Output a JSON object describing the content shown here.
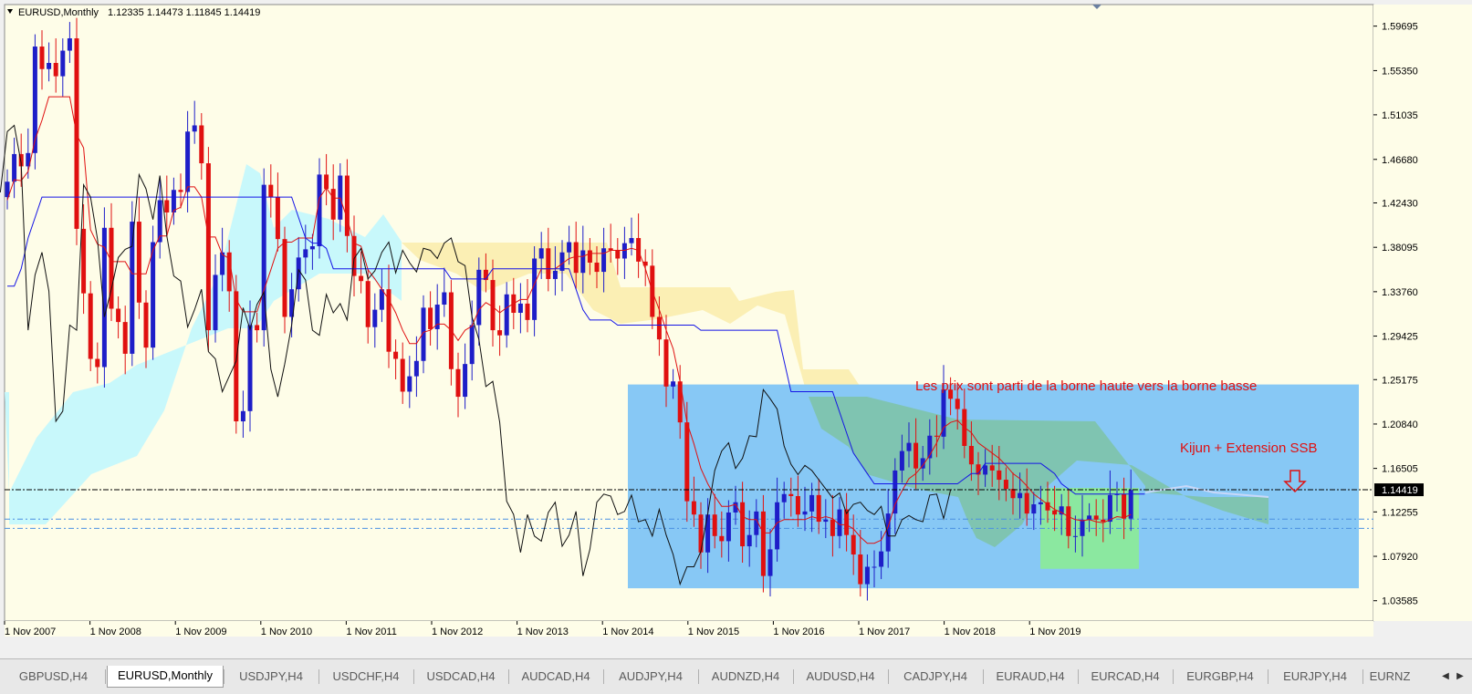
{
  "chart": {
    "symbol_info": "EURUSD,Monthly",
    "ohlc_text": "1.12335 1.14473 1.11845 1.14419",
    "current_price": "1.14419",
    "colors": {
      "background": "#fefde8",
      "bull": "#1e1ec8",
      "bear": "#e01010",
      "tenkan": "#e01010",
      "kijun": "#1414e6",
      "chikou": "#101010",
      "kumo_bull": "#c8f8fb",
      "kumo_bear": "#fbefb4",
      "range_box": "#87c8f5",
      "target_box": "#8be8a0",
      "annotation": "#e01010"
    },
    "annotations": [
      "Les prix sont parti de la borne haute vers la borne basse",
      "Kijun + Extension SSB"
    ],
    "arrow_icon": "down-arrow-icon"
  },
  "chart_data": {
    "type": "candlestick",
    "ylim": [
      1.016,
      1.618
    ],
    "price_ticks": [
      "1.59695",
      "1.55350",
      "1.51035",
      "1.46680",
      "1.42430",
      "1.38095",
      "1.33760",
      "1.29425",
      "1.25175",
      "1.20840",
      "1.16505",
      "1.12255",
      "1.07920",
      "1.03585"
    ],
    "time_ticks": [
      "1 Nov 2007",
      "1 Nov 2008",
      "1 Nov 2009",
      "1 Nov 2010",
      "1 Nov 2011",
      "1 Nov 2012",
      "1 Nov 2013",
      "1 Nov 2014",
      "1 Nov 2015",
      "1 Nov 2016",
      "1 Nov 2017",
      "1 Nov 2018",
      "1 Nov 2019"
    ],
    "levels": {
      "current": 1.14419,
      "dash_line_1": 1.1155,
      "dash_line_2": 1.1065
    },
    "range_box": {
      "top": 1.247,
      "bottom": 1.048
    },
    "target_box": {
      "top": 1.146,
      "bottom": 1.067
    },
    "series": [
      {
        "name": "EURUSD",
        "close": [
          1.445,
          1.472,
          1.46,
          1.473,
          1.577,
          1.555,
          1.561,
          1.548,
          1.573,
          1.585,
          1.399,
          1.336,
          1.272,
          1.264,
          1.4,
          1.321,
          1.308,
          1.277,
          1.406,
          1.327,
          1.283,
          1.386,
          1.427,
          1.415,
          1.437,
          1.435,
          1.494,
          1.5,
          1.463,
          1.3,
          1.354,
          1.376,
          1.338,
          1.211,
          1.221,
          1.305,
          1.3,
          1.442,
          1.43,
          1.389,
          1.313,
          1.34,
          1.371,
          1.379,
          1.382,
          1.452,
          1.438,
          1.408,
          1.451,
          1.392,
          1.353,
          1.348,
          1.303,
          1.32,
          1.34,
          1.279,
          1.272,
          1.24,
          1.255,
          1.27,
          1.322,
          1.301,
          1.325,
          1.337,
          1.262,
          1.235,
          1.267,
          1.305,
          1.359,
          1.349,
          1.3,
          1.295,
          1.335,
          1.317,
          1.326,
          1.31,
          1.37,
          1.38,
          1.35,
          1.358,
          1.376,
          1.386,
          1.356,
          1.378,
          1.366,
          1.357,
          1.38,
          1.378,
          1.37,
          1.385,
          1.39,
          1.367,
          1.363,
          1.313,
          1.291,
          1.245,
          1.25,
          1.21,
          1.133,
          1.12,
          1.083,
          1.12,
          1.099,
          1.094,
          1.122,
          1.132,
          1.089,
          1.1,
          1.123,
          1.06,
          1.086,
          1.132,
          1.14,
          1.138,
          1.12,
          1.123,
          1.139,
          1.113,
          1.115,
          1.099,
          1.125,
          1.1,
          1.081,
          1.052,
          1.069,
          1.069,
          1.084,
          1.121,
          1.163,
          1.182,
          1.19,
          1.165,
          1.175,
          1.197,
          1.196,
          1.242,
          1.233,
          1.223,
          1.187,
          1.169,
          1.159,
          1.168,
          1.163,
          1.154,
          1.145,
          1.136,
          1.141,
          1.121,
          1.13,
          1.132,
          1.124,
          1.12,
          1.128,
          1.099,
          1.099,
          1.115,
          1.119,
          1.115,
          1.113,
          1.139,
          1.14,
          1.116,
          1.144
        ]
      },
      {
        "name": "Tenkan",
        "values": [
          1.427,
          1.447,
          1.446,
          1.455,
          1.486,
          1.505,
          1.528,
          1.528,
          1.528,
          1.528,
          1.491,
          1.478,
          1.398,
          1.384,
          1.381,
          1.367,
          1.367,
          1.367,
          1.355,
          1.355,
          1.355,
          1.378,
          1.392,
          1.392,
          1.417,
          1.42,
          1.44,
          1.44,
          1.43,
          1.391,
          1.391,
          1.374,
          1.37,
          1.33,
          1.318,
          1.318,
          1.318,
          1.339,
          1.359,
          1.38,
          1.386,
          1.386,
          1.39,
          1.39,
          1.39,
          1.429,
          1.439,
          1.429,
          1.429,
          1.409,
          1.385,
          1.382,
          1.359,
          1.35,
          1.34,
          1.33,
          1.317,
          1.3,
          1.287,
          1.287,
          1.298,
          1.3,
          1.306,
          1.306,
          1.3,
          1.29,
          1.3,
          1.304,
          1.32,
          1.327,
          1.323,
          1.317,
          1.322,
          1.326,
          1.33,
          1.33,
          1.345,
          1.36,
          1.36,
          1.36,
          1.365,
          1.37,
          1.372,
          1.372,
          1.375,
          1.375,
          1.375,
          1.378,
          1.378,
          1.378,
          1.38,
          1.378,
          1.36,
          1.338,
          1.32,
          1.3,
          1.282,
          1.25,
          1.21,
          1.189,
          1.165,
          1.15,
          1.138,
          1.128,
          1.128,
          1.13,
          1.118,
          1.115,
          1.115,
          1.102,
          1.102,
          1.112,
          1.115,
          1.115,
          1.115,
          1.115,
          1.118,
          1.116,
          1.118,
          1.116,
          1.11,
          1.11,
          1.106,
          1.098,
          1.092,
          1.092,
          1.095,
          1.108,
          1.13,
          1.143,
          1.155,
          1.16,
          1.168,
          1.178,
          1.19,
          1.205,
          1.21,
          1.212,
          1.205,
          1.2,
          1.19,
          1.185,
          1.18,
          1.175,
          1.168,
          1.16,
          1.155,
          1.148,
          1.14,
          1.135,
          1.13,
          1.125,
          1.122,
          1.118,
          1.115,
          1.114,
          1.115,
          1.113,
          1.112,
          1.115,
          1.118,
          1.117,
          1.12
        ]
      },
      {
        "name": "Kijun",
        "values": [
          1.343,
          1.343,
          1.36,
          1.39,
          1.41,
          1.43,
          1.43,
          1.43,
          1.43,
          1.43,
          1.43,
          1.43,
          1.43,
          1.43,
          1.43,
          1.43,
          1.43,
          1.43,
          1.43,
          1.43,
          1.43,
          1.43,
          1.43,
          1.43,
          1.43,
          1.43,
          1.43,
          1.43,
          1.43,
          1.43,
          1.43,
          1.43,
          1.43,
          1.43,
          1.43,
          1.43,
          1.43,
          1.43,
          1.43,
          1.43,
          1.43,
          1.43,
          1.41,
          1.39,
          1.385,
          1.385,
          1.38,
          1.36,
          1.36,
          1.36,
          1.36,
          1.36,
          1.36,
          1.36,
          1.36,
          1.36,
          1.36,
          1.36,
          1.36,
          1.36,
          1.36,
          1.36,
          1.36,
          1.36,
          1.35,
          1.35,
          1.35,
          1.35,
          1.35,
          1.35,
          1.36,
          1.36,
          1.36,
          1.36,
          1.36,
          1.36,
          1.36,
          1.36,
          1.36,
          1.36,
          1.36,
          1.36,
          1.34,
          1.32,
          1.31,
          1.31,
          1.31,
          1.31,
          1.305,
          1.305,
          1.305,
          1.305,
          1.305,
          1.305,
          1.305,
          1.305,
          1.305,
          1.305,
          1.305,
          1.305,
          1.3,
          1.3,
          1.3,
          1.3,
          1.3,
          1.3,
          1.3,
          1.3,
          1.3,
          1.3,
          1.3,
          1.3,
          1.27,
          1.24,
          1.24,
          1.24,
          1.24,
          1.24,
          1.24,
          1.24,
          1.22,
          1.2,
          1.18,
          1.17,
          1.16,
          1.15,
          1.15,
          1.15,
          1.15,
          1.15,
          1.15,
          1.15,
          1.15,
          1.15,
          1.15,
          1.15,
          1.15,
          1.15,
          1.155,
          1.16,
          1.16,
          1.17,
          1.17,
          1.17,
          1.17,
          1.17,
          1.17,
          1.17,
          1.17,
          1.17,
          1.165,
          1.16,
          1.15,
          1.145,
          1.14,
          1.14,
          1.14,
          1.14,
          1.14,
          1.14,
          1.14,
          1.14,
          1.14,
          1.14,
          1.14
        ]
      }
    ]
  },
  "tabs": [
    {
      "label": "GBPUSD,H4",
      "active": false
    },
    {
      "label": "EURUSD,Monthly",
      "active": true
    },
    {
      "label": "USDJPY,H4",
      "active": false
    },
    {
      "label": "USDCHF,H4",
      "active": false
    },
    {
      "label": "USDCAD,H4",
      "active": false
    },
    {
      "label": "AUDCAD,H4",
      "active": false
    },
    {
      "label": "AUDJPY,H4",
      "active": false
    },
    {
      "label": "AUDNZD,H4",
      "active": false
    },
    {
      "label": "AUDUSD,H4",
      "active": false
    },
    {
      "label": "CADJPY,H4",
      "active": false
    },
    {
      "label": "EURAUD,H4",
      "active": false
    },
    {
      "label": "EURCAD,H4",
      "active": false
    },
    {
      "label": "EURGBP,H4",
      "active": false
    },
    {
      "label": "EURJPY,H4",
      "active": false
    },
    {
      "label": "EURNZ",
      "active": false
    }
  ],
  "scroll_icons": [
    "left-arrow-icon",
    "right-arrow-icon"
  ]
}
